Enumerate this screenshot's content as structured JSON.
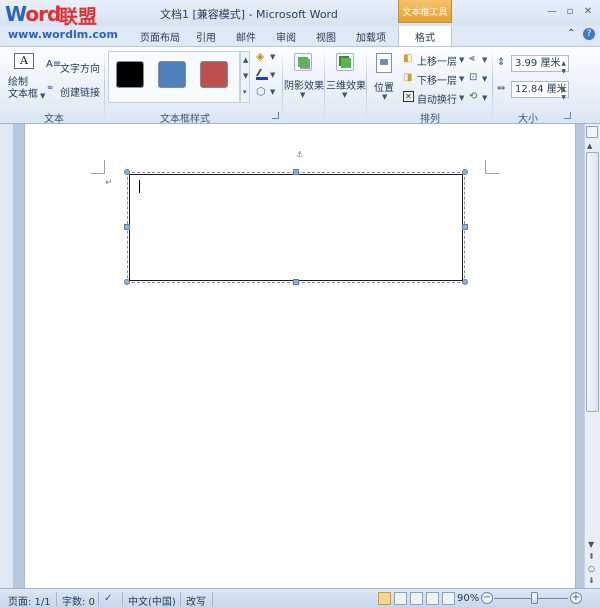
{
  "titlebar": {
    "title": "文档1 [兼容模式] - Microsoft Word",
    "contextual_group": "文本框工具",
    "minimize": "—",
    "restore": "▫",
    "close": "✕"
  },
  "watermark": {
    "brand": "Word",
    "brand_cn": "联盟",
    "url": "www.wordlm.com"
  },
  "tabs": {
    "items": [
      "页面布局",
      "引用",
      "邮件",
      "审阅",
      "视图",
      "加载项"
    ],
    "active": "格式",
    "help_icon": "?"
  },
  "ribbon": {
    "text_group": {
      "label": "文本",
      "draw_textbox": "绘制\n文本框",
      "text_direction": "文字方向",
      "create_link": "创建链接"
    },
    "textbox_styles": {
      "label": "文本框样式",
      "swatches": [
        "#000000",
        "#4f81bd",
        "#c0504d"
      ]
    },
    "shadow_effects": "阴影效果",
    "threed_effects": "三维效果",
    "arrange": {
      "label": "排列",
      "position": "位置",
      "bring_forward": "上移一层",
      "send_backward": "下移一层",
      "wrap_text": "自动换行"
    },
    "size": {
      "label": "大小",
      "height": "3.99 厘米",
      "width": "12.84 厘米"
    }
  },
  "statusbar": {
    "page": "页面: 1/1",
    "words": "字数: 0",
    "language": "中文(中国)",
    "mode": "改写",
    "zoom": "90%",
    "zoom_level": 0.55
  },
  "colors": {
    "accent_orange": "#e7a033",
    "brand_red": "#e53030",
    "brand_blue": "#2a63c6"
  }
}
